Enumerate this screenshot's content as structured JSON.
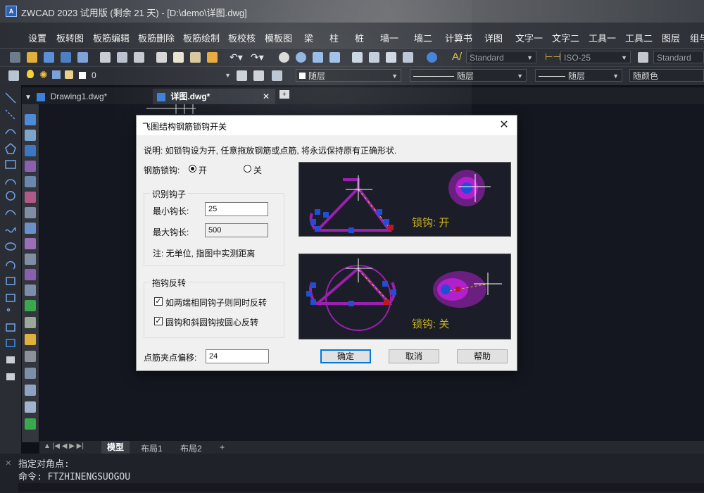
{
  "window": {
    "title": "ZWCAD 2023 试用版 (剩余 21 天) - [D:\\demo\\详图.dwg]"
  },
  "menu": [
    "设置",
    "板转图",
    "板筋编辑",
    "板筋删除",
    "板筋绘制",
    "板校核",
    "模板图",
    "梁",
    "柱",
    "桩",
    "墙一",
    "墙二",
    "计算书",
    "详图",
    "文字一",
    "文字二",
    "工具一",
    "工具二",
    "图层",
    "组与"
  ],
  "toolbar": {
    "text_style": "Standard",
    "dim_style": "ISO-25",
    "table_style": "Standard",
    "layer_name": "0",
    "color": "随层",
    "linetype": "随层",
    "lineweight": "随层",
    "plotstyle": "随颜色"
  },
  "tabs": [
    {
      "label": "Drawing1.dwg*",
      "active": false
    },
    {
      "label": "详图.dwg*",
      "active": true
    }
  ],
  "layout_tabs": [
    "模型",
    "布局1",
    "布局2",
    "+"
  ],
  "command": {
    "line1": "指定对角点:",
    "line2": "命令: FTZHINENGSUOGOU"
  },
  "dialog": {
    "title": "飞图结构钢筋锁钩开关",
    "description": "说明: 如锁钩设为开, 任意拖放钢筋或点筋, 将永远保持原有正确形状.",
    "lock_label": "钢筋锁钩:",
    "radio_on": "开",
    "radio_off": "关",
    "lock_state": "开",
    "identify_group": "识别钩子",
    "min_hook_label": "最小钩长:",
    "min_hook_value": "25",
    "max_hook_label": "最大钩长:",
    "max_hook_value": "500",
    "note": "注: 无单位, 指图中实测距离",
    "reverse_group": "拖钩反转",
    "check1": "如两端相同钩子则同时反转",
    "check1_checked": true,
    "check2": "圆钩和斜圆钩按圆心反转",
    "check2_checked": true,
    "offset_label": "点筋夹点偏移:",
    "offset_value": "24",
    "ok": "确定",
    "cancel": "取消",
    "help": "帮助",
    "preview_on_caption": "锁钩: 开",
    "preview_off_caption": "锁钩: 关"
  },
  "colors": {
    "rebar": "#9b1fb0",
    "grip": "#1e4fd6",
    "caption": "#c8b21e",
    "accent": "#0078d7"
  }
}
